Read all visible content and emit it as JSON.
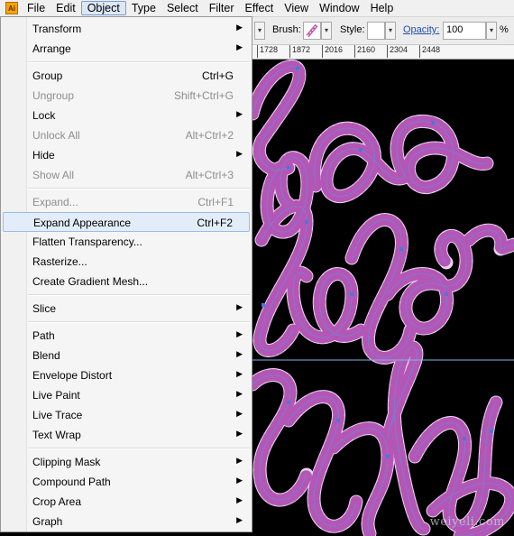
{
  "app": {
    "icon_label": "Ai"
  },
  "menubar": {
    "items": [
      "File",
      "Edit",
      "Object",
      "Type",
      "Select",
      "Filter",
      "Effect",
      "View",
      "Window",
      "Help"
    ],
    "active": "Object"
  },
  "control_bar": {
    "brush_label": "Brush:",
    "style_label": "Style:",
    "opacity_label": "Opacity:",
    "opacity_value": "100",
    "opacity_unit": "%",
    "dropdown_arrow": "▾"
  },
  "ruler": {
    "ticks": [
      "1728",
      "1872",
      "2016",
      "2160",
      "2304",
      "2448"
    ]
  },
  "object_menu": {
    "groups": [
      [
        {
          "label": "Transform",
          "submenu": true
        },
        {
          "label": "Arrange",
          "submenu": true
        }
      ],
      [
        {
          "label": "Group",
          "shortcut": "Ctrl+G"
        },
        {
          "label": "Ungroup",
          "shortcut": "Shift+Ctrl+G",
          "disabled": true
        },
        {
          "label": "Lock",
          "submenu": true
        },
        {
          "label": "Unlock All",
          "shortcut": "Alt+Ctrl+2",
          "disabled": true
        },
        {
          "label": "Hide",
          "submenu": true
        },
        {
          "label": "Show All",
          "shortcut": "Alt+Ctrl+3",
          "disabled": true
        }
      ],
      [
        {
          "label": "Expand...",
          "shortcut": "Ctrl+F1",
          "disabled": true
        },
        {
          "label": "Expand Appearance",
          "shortcut": "Ctrl+F2",
          "highlighted": true
        },
        {
          "label": "Flatten Transparency..."
        },
        {
          "label": "Rasterize..."
        },
        {
          "label": "Create Gradient Mesh..."
        }
      ],
      [
        {
          "label": "Slice",
          "submenu": true
        }
      ],
      [
        {
          "label": "Path",
          "submenu": true
        },
        {
          "label": "Blend",
          "submenu": true
        },
        {
          "label": "Envelope Distort",
          "submenu": true
        },
        {
          "label": "Live Paint",
          "submenu": true
        },
        {
          "label": "Live Trace",
          "submenu": true
        },
        {
          "label": "Text Wrap",
          "submenu": true
        }
      ],
      [
        {
          "label": "Clipping Mask",
          "submenu": true
        },
        {
          "label": "Compound Path",
          "submenu": true
        },
        {
          "label": "Crop Area",
          "submenu": true
        },
        {
          "label": "Graph",
          "submenu": true
        }
      ]
    ],
    "submenu_arrow": "▶"
  },
  "watermark": "weiyeli.com",
  "colors": {
    "stroke_outer": "#e9d6f0",
    "stroke_stripe": "#b25cb3",
    "anchor": "#4b78d8",
    "guide": "#7fb7e6"
  }
}
